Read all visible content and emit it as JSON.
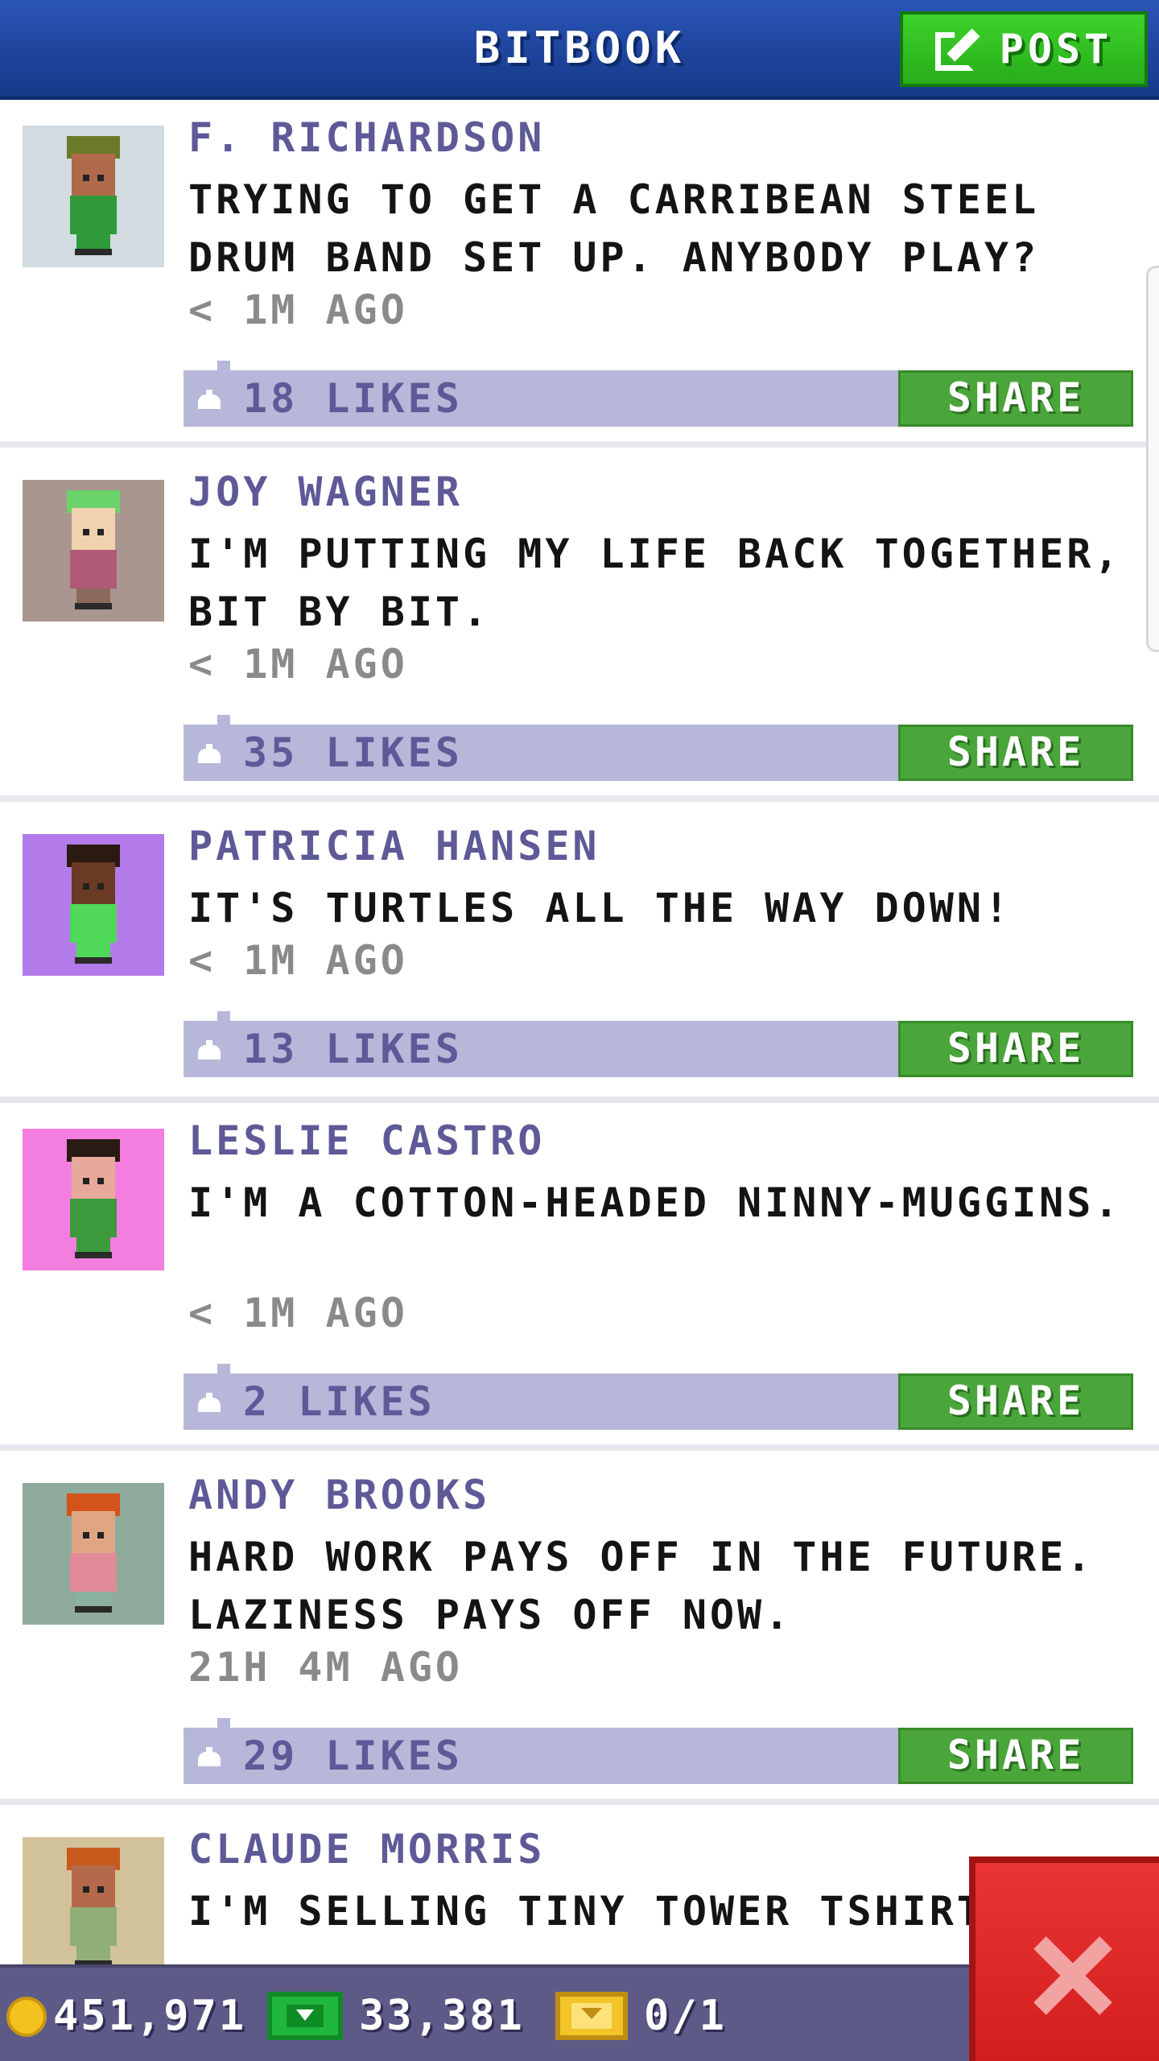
{
  "header": {
    "title": "BITBOOK",
    "post_label": "POST"
  },
  "posts": [
    {
      "author": "F. RICHARDSON",
      "message": "TRYING TO GET A CARRIBEAN STEEL DRUM BAND SET UP. ANYBODY PLAY?",
      "time": "< 1M AGO",
      "likes": "18 LIKES",
      "share_label": "SHARE",
      "avatar_bg": "#d1dbe0",
      "hat": "#6b7a2a",
      "skin": "#b06a4a",
      "shirt": "#2e9a3a",
      "pants": "#2e9a3a"
    },
    {
      "author": "JOY WAGNER",
      "message": "I'M PUTTING MY LIFE BACK TOGETHER, BIT BY BIT.",
      "time": "< 1M AGO",
      "likes": "35 LIKES",
      "share_label": "SHARE",
      "avatar_bg": "#a8968f",
      "hat": "#6ad36a",
      "skin": "#f1d2b0",
      "shirt": "#b05a78",
      "pants": "#8a6a5a"
    },
    {
      "author": "PATRICIA HANSEN",
      "message": "IT'S TURTLES ALL THE WAY DOWN!",
      "time": "< 1M AGO",
      "likes": "13 LIKES",
      "share_label": "SHARE",
      "avatar_bg": "#b27be9",
      "hat": "#2a1a12",
      "skin": "#6a3a24",
      "shirt": "#4fd85a",
      "pants": "#4fd85a"
    },
    {
      "author": "LESLIE CASTRO",
      "message": "I'M A COTTON-HEADED NINNY-MUGGINS.",
      "time": "< 1M AGO",
      "likes": "2 LIKES",
      "share_label": "SHARE",
      "avatar_bg": "#f47ee0",
      "hat": "#2a1a14",
      "skin": "#e7a99a",
      "shirt": "#3c9a3c",
      "pants": "#3c9a3c"
    },
    {
      "author": "ANDY BROOKS",
      "message": "HARD WORK PAYS OFF IN THE FUTURE. LAZINESS PAYS OFF NOW.",
      "time": "21H 4M AGO",
      "likes": "29 LIKES",
      "share_label": "SHARE",
      "avatar_bg": "#8eab9b",
      "hat": "#d2541a",
      "skin": "#e0a684",
      "shirt": "#e08a9a",
      "pants": "#8ab0a0"
    },
    {
      "author": "CLAUDE MORRIS",
      "message": "I'M SELLING TINY TOWER TSHIRTS",
      "time": "",
      "likes": "",
      "share_label": "",
      "avatar_bg": "#d2c29a",
      "hat": "#c85a1e",
      "skin": "#b46a4a",
      "shirt": "#8fae78",
      "pants": "#8fae78"
    }
  ],
  "status": {
    "coins": "451,971",
    "bux": "33,381",
    "tickets": "0/1"
  },
  "icons": {
    "post": "edit-icon",
    "like": "like-icon",
    "coin": "coin-icon",
    "bux": "bux-icon",
    "ticket": "ticket-icon",
    "close": "close-icon"
  }
}
